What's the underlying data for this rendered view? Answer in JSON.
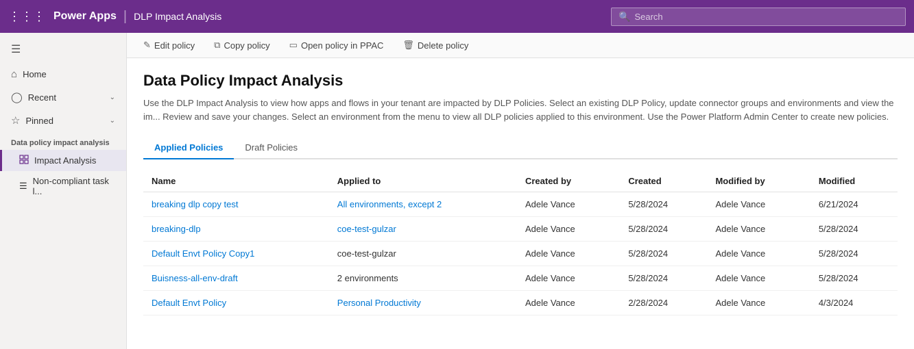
{
  "topNav": {
    "brand": "Power Apps",
    "divider": "|",
    "pageTitle": "DLP Impact Analysis",
    "search": {
      "placeholder": "Search"
    }
  },
  "sidebar": {
    "hamburger": "☰",
    "items": [
      {
        "id": "home",
        "icon": "⌂",
        "label": "Home"
      },
      {
        "id": "recent",
        "icon": "◷",
        "label": "Recent",
        "hasChevron": true
      },
      {
        "id": "pinned",
        "icon": "☆",
        "label": "Pinned",
        "hasChevron": true
      }
    ],
    "sectionLabel": "Data policy impact analysis",
    "subItems": [
      {
        "id": "impact-analysis",
        "icon": "▦",
        "label": "Impact Analysis",
        "active": true
      },
      {
        "id": "non-compliant",
        "icon": "≡",
        "label": "Non-compliant task l..."
      }
    ]
  },
  "toolbar": {
    "buttons": [
      {
        "id": "edit-policy",
        "icon": "✎",
        "label": "Edit policy"
      },
      {
        "id": "copy-policy",
        "icon": "⧉",
        "label": "Copy policy"
      },
      {
        "id": "open-ppac",
        "icon": "⎋",
        "label": "Open policy in PPAC"
      },
      {
        "id": "delete-policy",
        "icon": "🗑",
        "label": "Delete policy"
      }
    ]
  },
  "page": {
    "title": "Data Policy Impact Analysis",
    "description": "Use the DLP Impact Analysis to view how apps and flows in your tenant are impacted by DLP Policies. Select an existing DLP Policy, update connector groups and environments and view the im... Review and save your changes. Select an environment from the menu to view all DLP policies applied to this environment. Use the Power Platform Admin Center to create new policies."
  },
  "tabs": [
    {
      "id": "applied-policies",
      "label": "Applied Policies",
      "active": true
    },
    {
      "id": "draft-policies",
      "label": "Draft Policies",
      "active": false
    }
  ],
  "table": {
    "columns": [
      {
        "id": "name",
        "label": "Name"
      },
      {
        "id": "applied-to",
        "label": "Applied to"
      },
      {
        "id": "created-by",
        "label": "Created by"
      },
      {
        "id": "created",
        "label": "Created"
      },
      {
        "id": "modified-by",
        "label": "Modified by"
      },
      {
        "id": "modified",
        "label": "Modified"
      }
    ],
    "rows": [
      {
        "name": "breaking dlp copy test",
        "appliedTo": "All environments, except 2",
        "createdBy": "Adele Vance",
        "created": "5/28/2024",
        "modifiedBy": "Adele Vance",
        "modified": "6/21/2024",
        "nameIsLink": true,
        "appliedToIsLink": true
      },
      {
        "name": "breaking-dlp",
        "appliedTo": "coe-test-gulzar",
        "createdBy": "Adele Vance",
        "created": "5/28/2024",
        "modifiedBy": "Adele Vance",
        "modified": "5/28/2024",
        "nameIsLink": true,
        "appliedToIsLink": true
      },
      {
        "name": "Default Envt Policy Copy1",
        "appliedTo": "coe-test-gulzar",
        "createdBy": "Adele Vance",
        "created": "5/28/2024",
        "modifiedBy": "Adele Vance",
        "modified": "5/28/2024",
        "nameIsLink": true,
        "appliedToIsLink": false
      },
      {
        "name": "Buisness-all-env-draft",
        "appliedTo": "2 environments",
        "createdBy": "Adele Vance",
        "created": "5/28/2024",
        "modifiedBy": "Adele Vance",
        "modified": "5/28/2024",
        "nameIsLink": true,
        "appliedToIsLink": false
      },
      {
        "name": "Default Envt Policy",
        "appliedTo": "Personal Productivity",
        "createdBy": "Adele Vance",
        "created": "2/28/2024",
        "modifiedBy": "Adele Vance",
        "modified": "4/3/2024",
        "nameIsLink": true,
        "appliedToIsLink": true
      }
    ]
  }
}
